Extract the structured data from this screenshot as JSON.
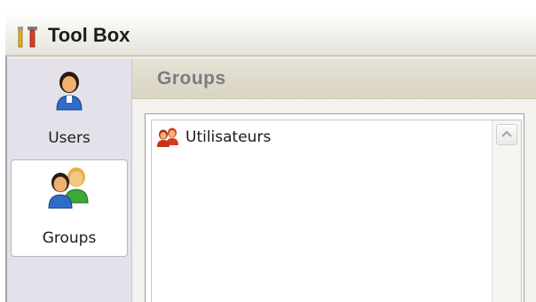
{
  "window": {
    "title": "Tool Box"
  },
  "nav": {
    "items": [
      {
        "label": "Users",
        "icon": "user-icon",
        "selected": false
      },
      {
        "label": "Groups",
        "icon": "group-icon",
        "selected": true
      }
    ]
  },
  "main": {
    "section_title": "Groups",
    "list": {
      "items": [
        {
          "label": "Utilisateurs",
          "icon": "group-icon"
        }
      ]
    }
  },
  "colors": {
    "nav_background": "#e4e1ea",
    "header_background": "#d9d4c3",
    "header_text": "#7b7b83"
  }
}
